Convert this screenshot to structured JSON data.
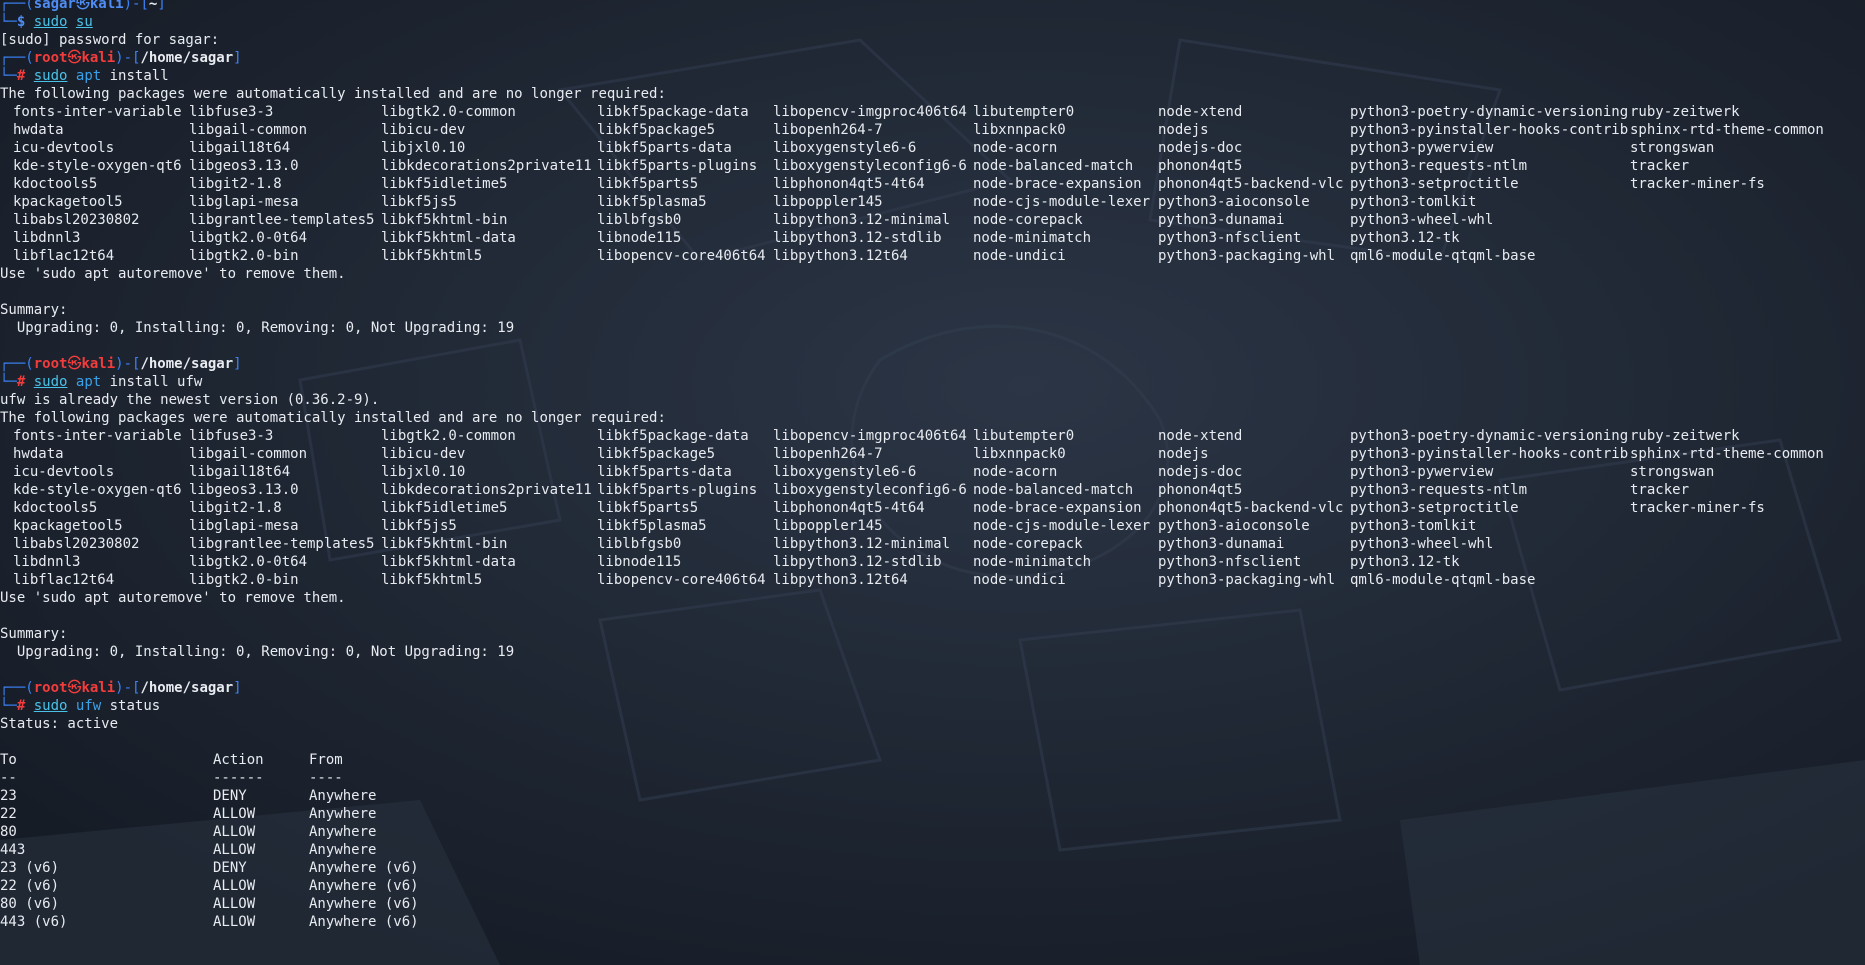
{
  "prompts": {
    "user": {
      "user": "sagar",
      "host": "kali",
      "path": "~",
      "symbol": "$"
    },
    "root": {
      "user": "root",
      "host": "kali",
      "path": "/home/sagar",
      "symbol": "#"
    }
  },
  "cmd1": {
    "sudo": "sudo",
    "rest": "su"
  },
  "password_prompt": "[sudo] password for sagar:",
  "cmd2": {
    "sudo": "sudo",
    "apt": "apt",
    "rest": "install"
  },
  "auto_msg": "The following packages were automatically installed and are no longer required:",
  "packages": [
    [
      "fonts-inter-variable",
      "libfuse3-3",
      "libgtk2.0-common",
      "libkf5package-data",
      "libopencv-imgproc406t64",
      "libutempter0",
      "node-xtend",
      "python3-poetry-dynamic-versioning",
      "ruby-zeitwerk"
    ],
    [
      "hwdata",
      "libgail-common",
      "libicu-dev",
      "libkf5package5",
      "libopenh264-7",
      "libxnnpack0",
      "nodejs",
      "python3-pyinstaller-hooks-contrib",
      "sphinx-rtd-theme-common"
    ],
    [
      "icu-devtools",
      "libgail18t64",
      "libjxl0.10",
      "libkf5parts-data",
      "liboxygenstyle6-6",
      "node-acorn",
      "nodejs-doc",
      "python3-pywerview",
      "strongswan"
    ],
    [
      "kde-style-oxygen-qt6",
      "libgeos3.13.0",
      "libkdecorations2private11",
      "libkf5parts-plugins",
      "liboxygenstyleconfig6-6",
      "node-balanced-match",
      "phonon4qt5",
      "python3-requests-ntlm",
      "tracker"
    ],
    [
      "kdoctools5",
      "libgit2-1.8",
      "libkf5idletime5",
      "libkf5parts5",
      "libphonon4qt5-4t64",
      "node-brace-expansion",
      "phonon4qt5-backend-vlc",
      "python3-setproctitle",
      "tracker-miner-fs"
    ],
    [
      "kpackagetool5",
      "libglapi-mesa",
      "libkf5js5",
      "libkf5plasma5",
      "libpoppler145",
      "node-cjs-module-lexer",
      "python3-aioconsole",
      "python3-tomlkit",
      ""
    ],
    [
      "libabsl20230802",
      "libgrantlee-templates5",
      "libkf5khtml-bin",
      "liblbfgsb0",
      "libpython3.12-minimal",
      "node-corepack",
      "python3-dunamai",
      "python3-wheel-whl",
      ""
    ],
    [
      "libdnnl3",
      "libgtk2.0-0t64",
      "libkf5khtml-data",
      "libnode115",
      "libpython3.12-stdlib",
      "node-minimatch",
      "python3-nfsclient",
      "python3.12-tk",
      ""
    ],
    [
      "libflac12t64",
      "libgtk2.0-bin",
      "libkf5khtml5",
      "libopencv-core406t64",
      "libpython3.12t64",
      "node-undici",
      "python3-packaging-whl",
      "qml6-module-qtqml-base",
      ""
    ]
  ],
  "autoremove_msg": "Use 'sudo apt autoremove' to remove them.",
  "summary_label": "Summary:",
  "summary_line": "  Upgrading: 0, Installing: 0, Removing: 0, Not Upgrading: 19",
  "cmd3": {
    "sudo": "sudo",
    "apt": "apt",
    "rest": "install ufw"
  },
  "ufw_newest": "ufw is already the newest version (0.36.2-9).",
  "cmd4": {
    "sudo": "sudo",
    "ufw": "ufw",
    "rest": "status"
  },
  "status_line": "Status: active",
  "ufw_table": {
    "headers": [
      "To",
      "Action",
      "From"
    ],
    "seps": [
      "--",
      "------",
      "----"
    ],
    "rows": [
      [
        "23",
        "DENY",
        "Anywhere"
      ],
      [
        "22",
        "ALLOW",
        "Anywhere"
      ],
      [
        "80",
        "ALLOW",
        "Anywhere"
      ],
      [
        "443",
        "ALLOW",
        "Anywhere"
      ],
      [
        "23 (v6)",
        "DENY",
        "Anywhere (v6)"
      ],
      [
        "22 (v6)",
        "ALLOW",
        "Anywhere (v6)"
      ],
      [
        "80 (v6)",
        "ALLOW",
        "Anywhere (v6)"
      ],
      [
        "443 (v6)",
        "ALLOW",
        "Anywhere (v6)"
      ]
    ]
  },
  "colors": {
    "background": "#1c2431",
    "root_red": "#f33c3c",
    "user_blue": "#4f8df5",
    "cmd_cyan": "#4ac2e8"
  }
}
